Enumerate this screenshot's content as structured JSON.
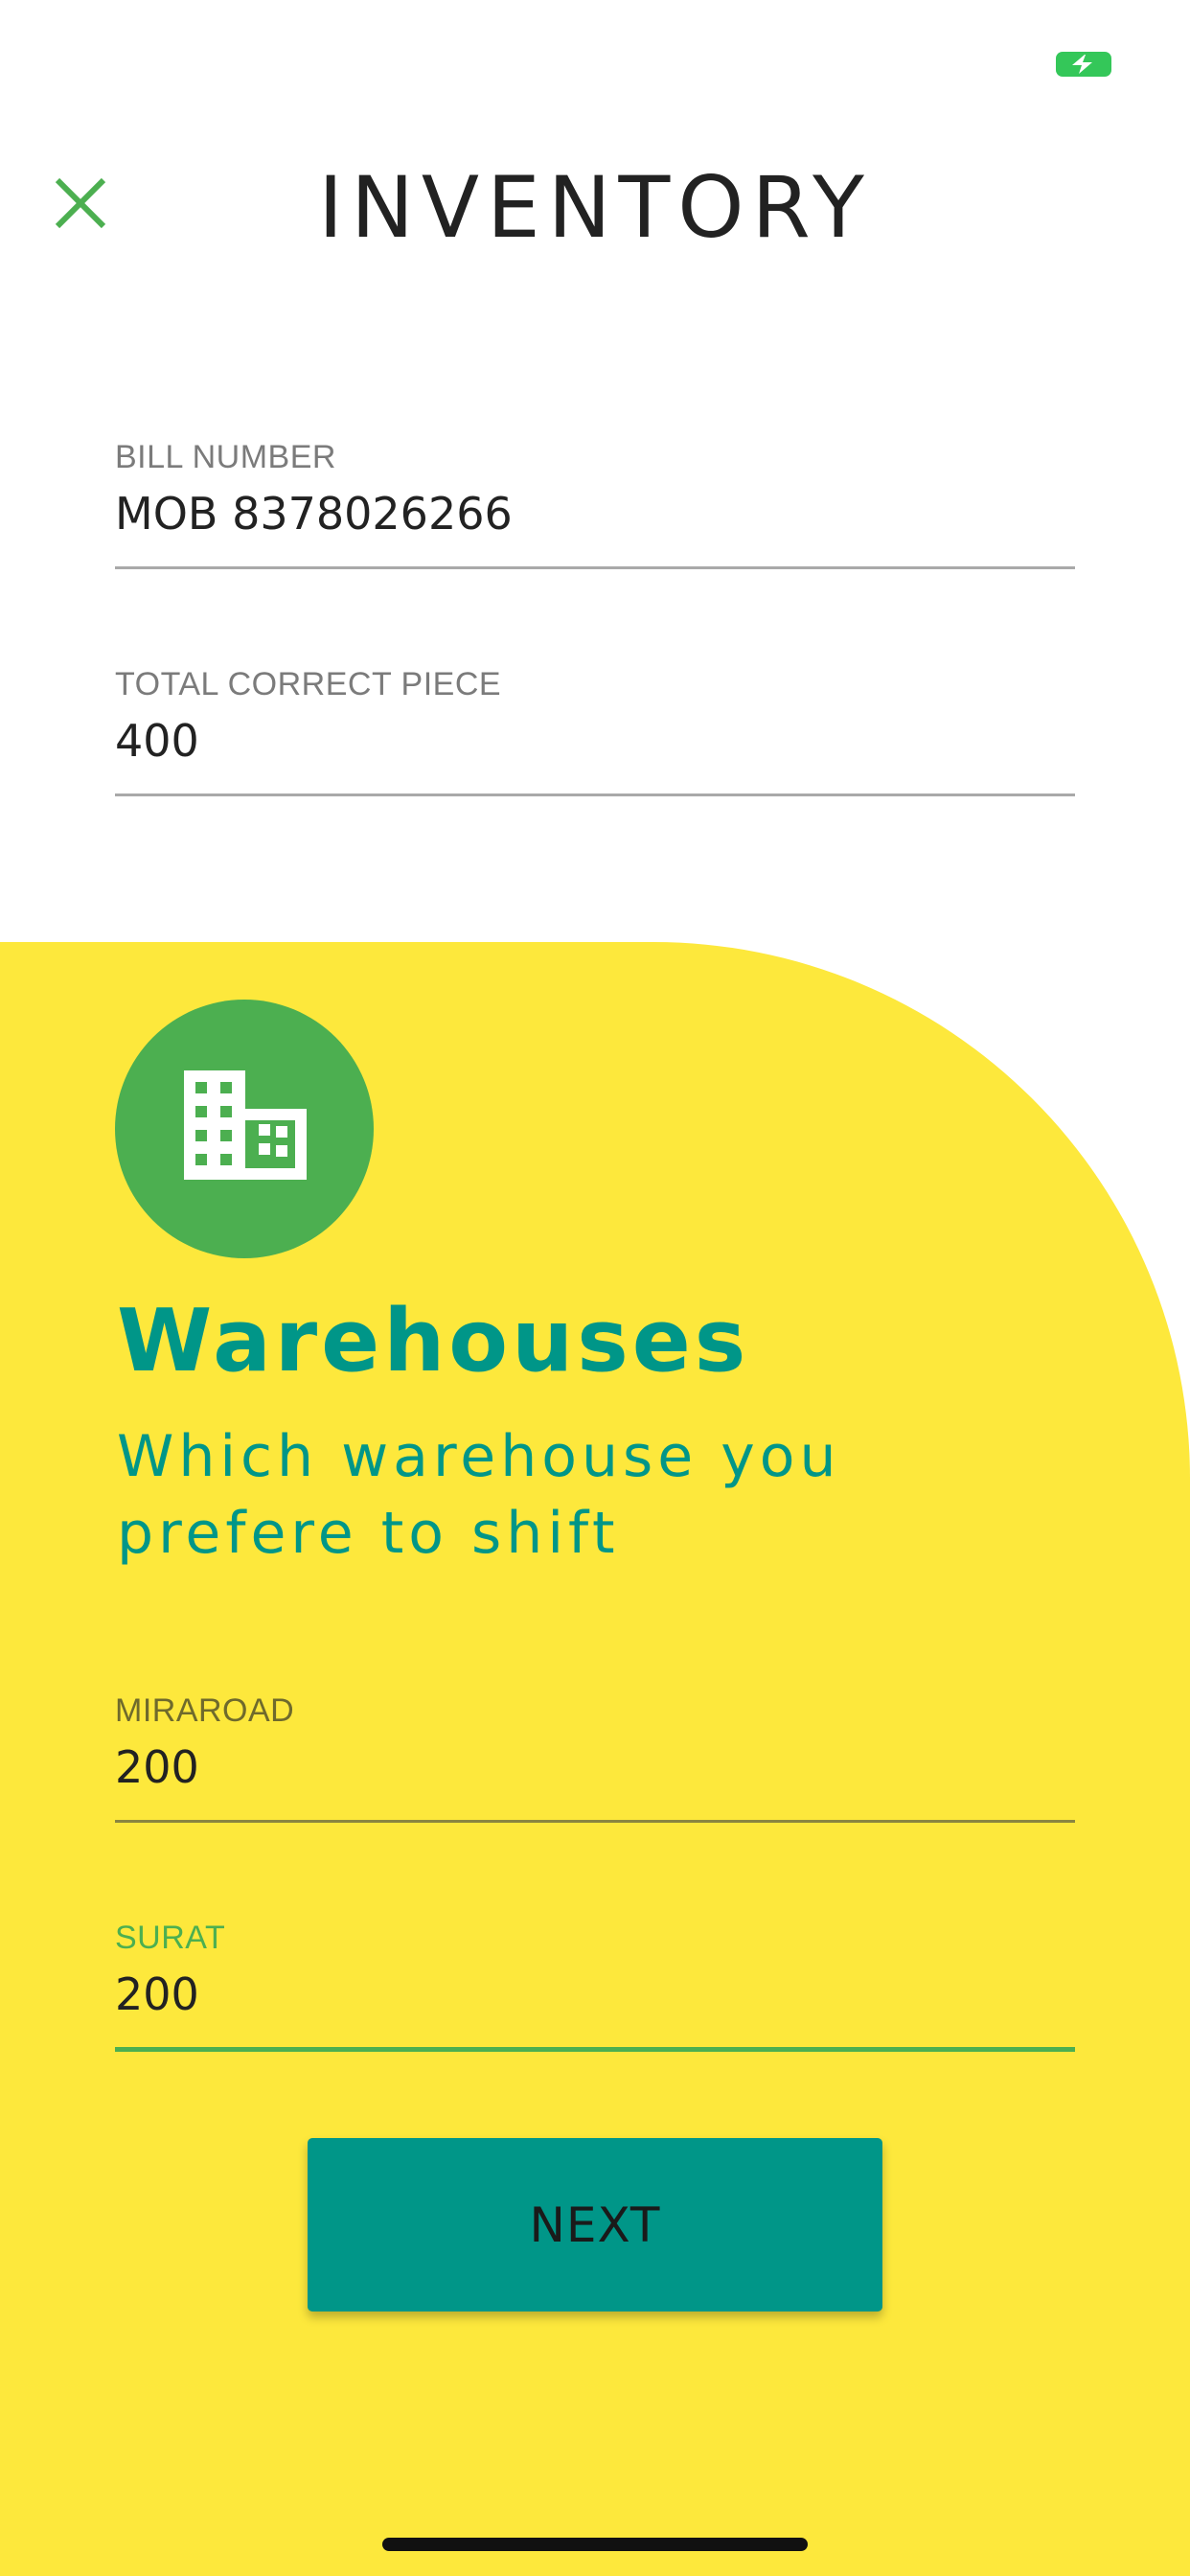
{
  "status_bar": {
    "battery_icon": "battery-charging-icon",
    "battery_color": "#34c759"
  },
  "header": {
    "title": "INVENTORY",
    "close_icon": "close-icon"
  },
  "form": {
    "bill_number": {
      "label": "BILL NUMBER",
      "value": "MOB 8378026266"
    },
    "total_correct_piece": {
      "label": "TOTAL CORRECT PIECE",
      "value": "400"
    }
  },
  "warehouses": {
    "icon": "building-icon",
    "title": "Warehouses",
    "subtitle": "Which warehouse you prefere to shift",
    "fields": [
      {
        "label": "MIRAROAD",
        "value": "200"
      },
      {
        "label": "SURAT",
        "value": "200"
      }
    ],
    "next_label": "NEXT"
  },
  "colors": {
    "accent_green": "#4caf50",
    "teal": "#009688",
    "panel_yellow": "#fde83c"
  }
}
